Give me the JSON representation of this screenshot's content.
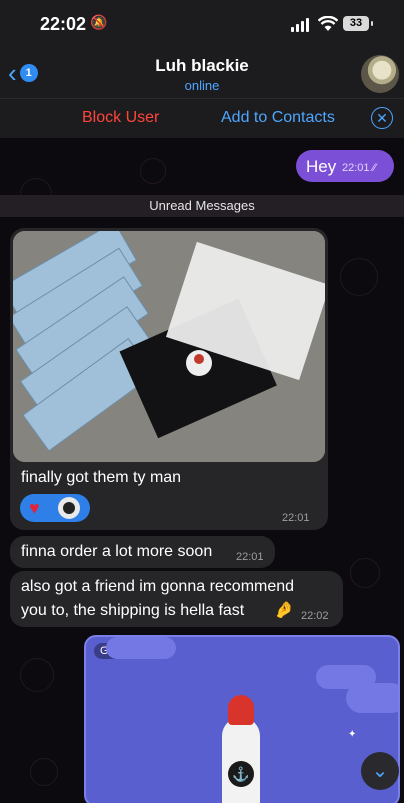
{
  "status_bar": {
    "time": "22:02",
    "battery": "33"
  },
  "header": {
    "back_badge": "1",
    "name": "Luh blackie",
    "status": "online"
  },
  "actions": {
    "block": "Block User",
    "add_contact": "Add to Contacts"
  },
  "messages": {
    "outgoing_text": "Hey",
    "outgoing_time": "22:01",
    "unread_label": "Unread Messages",
    "photo_caption": "finally got them ty man",
    "photo_time": "22:01",
    "msg2_text": "finna order a lot more soon",
    "msg2_time": "22:01",
    "msg3_line1": "also got a friend im gonna recommend",
    "msg3_line2": "you to, the shipping is hella fast",
    "msg3_time": "22:02",
    "gif_label": "GIF"
  },
  "colors": {
    "accent": "#4ea6ff",
    "danger": "#ff453a",
    "outgoing": "#7b4fd6",
    "incoming": "#262628"
  }
}
